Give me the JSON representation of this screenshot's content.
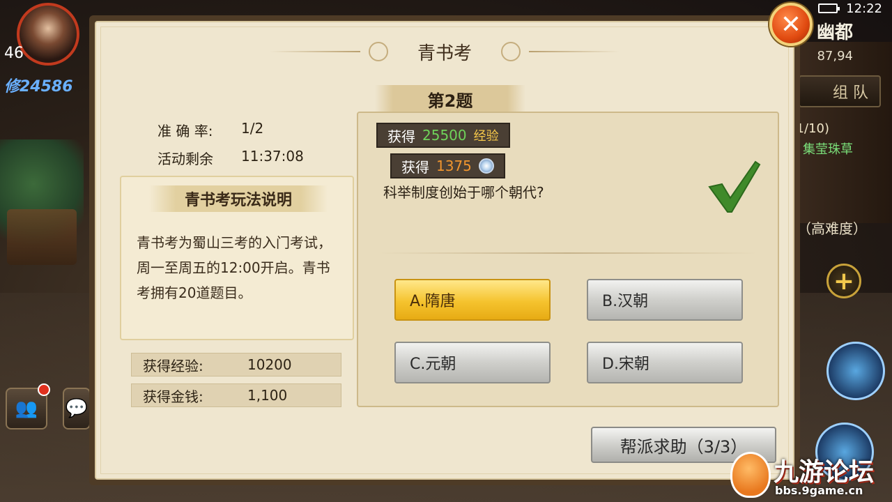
{
  "status_bar": {
    "time": "12:22"
  },
  "player": {
    "level": "46",
    "power": "修24586"
  },
  "hud": {
    "zone": "幽都",
    "coords": "87,94",
    "team_label": "组 队",
    "quest_progress": "(1/10)",
    "quest_name": "集莹珠草",
    "difficulty": "（高难度）",
    "plus_symbol": "+"
  },
  "dialog": {
    "title": "青书考",
    "accuracy_label": "准 确 率:",
    "accuracy_value": "1/2",
    "remaining_label": "活动剩余",
    "remaining_value": "11:37:08",
    "rules_title": "青书考玩法说明",
    "rules_text": "青书考为蜀山三考的入门考试，周一至周五的12:00开启。青书考拥有20道题目。",
    "earned_exp_label": "获得经验:",
    "earned_exp_value": "10200",
    "earned_money_label": "获得金钱:",
    "earned_money_value": "1,100",
    "question_number": "第2题",
    "reward_exp_prefix": "获得",
    "reward_exp_value": "25500",
    "reward_exp_unit": "经验",
    "reward_coin_prefix": "获得",
    "reward_coin_value": "1375",
    "question": "科举制度创始于哪个朝代?",
    "options": [
      {
        "label": "A.隋唐",
        "selected": true
      },
      {
        "label": "B.汉朝",
        "selected": false
      },
      {
        "label": "C.元朝",
        "selected": false
      },
      {
        "label": "D.宋朝",
        "selected": false
      }
    ],
    "help_button": "帮派求助（3/3）",
    "close_icon": "close-icon",
    "check_icon": "checkmark-icon"
  },
  "watermark": {
    "title": "九游论坛",
    "url": "bbs.9game.cn"
  },
  "colors": {
    "selected_option": "#f5c32e",
    "exp_value": "#6fd35a",
    "coin_value": "#f0952e",
    "close_button": "#e04a10"
  }
}
